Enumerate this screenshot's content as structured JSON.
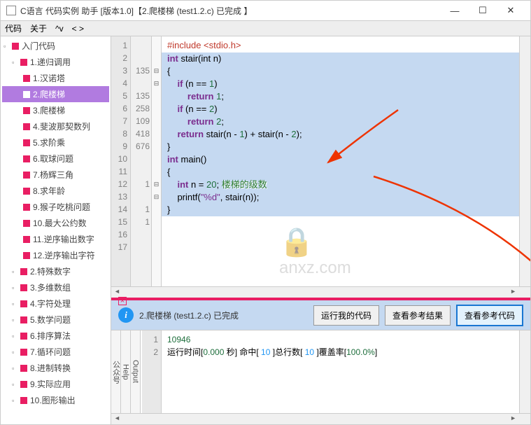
{
  "window": {
    "title": "C语言 代码实例 助手 [版本1.0]【2.爬楼梯 (test1.2.c) 已完成 】",
    "min": "—",
    "max": "☐",
    "close": "✕"
  },
  "menu": {
    "m1": "代码",
    "m2": "关于",
    "m3": "^v",
    "m4": "< >"
  },
  "tree": {
    "root": "入门代码",
    "g1": {
      "label": "1.递归调用",
      "items": [
        "1.汉诺塔",
        "2.爬楼梯",
        "3.爬楼梯",
        "4.斐波那契数列",
        "5.求阶乘",
        "6.取球问题",
        "7.杨辉三角",
        "8.求年龄",
        "9.猴子吃桃问题",
        "10.最大公约数",
        "11.逆序输出数字",
        "12.逆序输出字符"
      ],
      "selected": 1
    },
    "others": [
      "2.特殊数字",
      "3.多维数组",
      "4.字符处理",
      "5.数学问题",
      "6.排序算法",
      "7.循环问题",
      "8.进制转换",
      "9.实际应用",
      "10.图形输出"
    ]
  },
  "code": {
    "lines": [
      {
        "n": "1",
        "c": "",
        "fold": "",
        "text": "#include <stdio.h>",
        "cls": "pre"
      },
      {
        "n": "2",
        "c": "",
        "fold": "",
        "text": ""
      },
      {
        "n": "3",
        "c": "135",
        "fold": "⊟",
        "text": "int stair(int n)",
        "hl": true,
        "kw": [
          "int",
          "int"
        ]
      },
      {
        "n": "4",
        "c": "",
        "fold": "⊟",
        "text": "{",
        "hl": true
      },
      {
        "n": "5",
        "c": "135",
        "fold": "",
        "text": "    if (n == 1)",
        "hl": true,
        "kw": [
          "if"
        ],
        "num": [
          "1"
        ]
      },
      {
        "n": "6",
        "c": "258",
        "fold": "",
        "text": "        return 1;",
        "hl": true,
        "kw": [
          "return"
        ],
        "num": [
          "1"
        ]
      },
      {
        "n": "7",
        "c": "109",
        "fold": "",
        "text": "    if (n == 2)",
        "hl": true,
        "kw": [
          "if"
        ],
        "num": [
          "2"
        ]
      },
      {
        "n": "8",
        "c": "418",
        "fold": "",
        "text": "        return 2;",
        "hl": true,
        "kw": [
          "return"
        ],
        "num": [
          "2"
        ]
      },
      {
        "n": "9",
        "c": "676",
        "fold": "",
        "text": "    return stair(n - 1) + stair(n - 2);",
        "hl": true,
        "kw": [
          "return"
        ],
        "num": [
          "1",
          "2"
        ]
      },
      {
        "n": "10",
        "c": "",
        "fold": "",
        "text": "}",
        "hl": true
      },
      {
        "n": "11",
        "c": "",
        "fold": "",
        "text": ""
      },
      {
        "n": "12",
        "c": "1",
        "fold": "⊟",
        "text": "int main()",
        "hl": true,
        "kw": [
          "int"
        ]
      },
      {
        "n": "13",
        "c": "",
        "fold": "⊟",
        "text": "{",
        "hl": true
      },
      {
        "n": "14",
        "c": "1",
        "fold": "",
        "text": "    int n = 20;",
        "hl": true,
        "kw": [
          "int"
        ],
        "num": [
          "20"
        ],
        "anno": "楼梯的级数"
      },
      {
        "n": "15",
        "c": "1",
        "fold": "",
        "text": "    printf(\"%d\", stair(n));",
        "hl": true,
        "str": [
          "\"%d\""
        ]
      },
      {
        "n": "16",
        "c": "",
        "fold": "",
        "text": "}",
        "hl": true
      },
      {
        "n": "17",
        "c": "",
        "fold": "",
        "text": ""
      }
    ]
  },
  "action": {
    "label": "2.爬楼梯 (test1.2.c) 已完成",
    "b1": "运行我的代码",
    "b2": "查看参考结果",
    "b3": "查看参考代码"
  },
  "vtabs": {
    "t1": "公众号",
    "t2": "Help",
    "t3": "Output"
  },
  "output": {
    "lines": [
      {
        "n": "1",
        "html": "10946"
      },
      {
        "n": "2",
        "html": "运行时间[0.000 秒] 命中[ 10 ]总行数[ 10 ]覆盖率[100.0%]"
      }
    ],
    "result": "10946",
    "runtime": "0.000 秒",
    "hits": "10",
    "total_lines": "10",
    "coverage": "100.0%"
  },
  "watermark": "anxz.com"
}
